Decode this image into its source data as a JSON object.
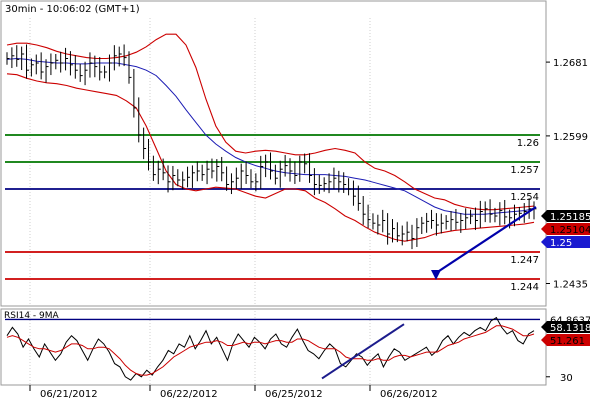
{
  "header": {
    "text": "30min - 10:06:02 (GMT+1)"
  },
  "colors": {
    "background": "#ffffff",
    "frame": "#9a9a9a",
    "grid": "#cfcfcf",
    "price": "#000000",
    "bollinger": "#cc0000",
    "moving_average": "#1c1cb4",
    "level_green": "#007700",
    "level_blue": "#000080",
    "level_red": "#cc0000",
    "trendline": "#1c1c8c",
    "forecast_arrow": "#0000aa",
    "tag_black": "#000000",
    "tag_red": "#cc0000",
    "tag_blue": "#1a1ad0"
  },
  "chart_data": [
    {
      "type": "line",
      "subtype": "ohlc-bars",
      "title": "",
      "x_ticks": [
        "06/21/2012",
        "06/22/2012",
        "06/25/2012",
        "06/26/2012"
      ],
      "y_ticks": [
        1.2681,
        1.2599,
        1.2435
      ],
      "ylim": [
        1.241,
        1.273
      ],
      "grid": true,
      "horizontal_levels": [
        {
          "value": 1.26,
          "label": "1.26",
          "color": "green"
        },
        {
          "value": 1.257,
          "label": "1.257",
          "color": "green"
        },
        {
          "value": 1.254,
          "label": "1.254",
          "color": "blue"
        },
        {
          "value": 1.247,
          "label": "1.247",
          "color": "red"
        },
        {
          "value": 1.244,
          "label": "1.244",
          "color": "red"
        }
      ],
      "value_tags": [
        {
          "value": 1.25185,
          "label": "1.25185",
          "style": "black"
        },
        {
          "value": 1.25104,
          "label": "1.25104",
          "style": "red"
        },
        {
          "value": 1.25,
          "label": "1.25",
          "style": "blue"
        }
      ],
      "series": [
        {
          "role": "price",
          "style": "ohlc",
          "values": [
            1.2685,
            1.2688,
            1.2684,
            1.269,
            1.2672,
            1.2678,
            1.268,
            1.267,
            1.2676,
            1.268,
            1.2683,
            1.268,
            1.2685,
            1.2678,
            1.2672,
            1.2666,
            1.2672,
            1.268,
            1.2676,
            1.267,
            1.267,
            1.268,
            1.2688,
            1.269,
            1.2686,
            1.2664,
            1.263,
            1.26,
            1.2585,
            1.257,
            1.2556,
            1.2562,
            1.2558,
            1.2548,
            1.2555,
            1.255,
            1.255,
            1.2553,
            1.2558,
            1.256,
            1.2556,
            1.2562,
            1.256,
            1.2565,
            1.2558,
            1.2545,
            1.2548,
            1.2552,
            1.256,
            1.2555,
            1.2548,
            1.2548,
            1.2565,
            1.257,
            1.256,
            1.2552,
            1.2562,
            1.2566,
            1.256,
            1.2555,
            1.257,
            1.2568,
            1.2555,
            1.2545,
            1.2544,
            1.2546,
            1.2548,
            1.2552,
            1.2548,
            1.2545,
            1.254,
            1.2532,
            1.2524,
            1.2512,
            1.2506,
            1.2502,
            1.25,
            1.2505,
            1.249,
            1.2496,
            1.2488,
            1.249,
            1.2492,
            1.2485,
            1.2497,
            1.2502,
            1.2504,
            1.2505,
            1.25,
            1.2502,
            1.2504,
            1.2506,
            1.2503,
            1.2505,
            1.2508,
            1.251,
            1.2505,
            1.2515,
            1.2518,
            1.2512,
            1.251,
            1.2516,
            1.2509,
            1.2508,
            1.2512,
            1.2513,
            1.2515,
            1.2518,
            1.2518
          ]
        },
        {
          "role": "bollinger_upper",
          "values": [
            1.27,
            1.2702,
            1.2702,
            1.27,
            1.2697,
            1.2693,
            1.269,
            1.2688,
            1.2686,
            1.2685,
            1.2685,
            1.2686,
            1.2688,
            1.2692,
            1.2698,
            1.2706,
            1.2712,
            1.2712,
            1.27,
            1.2675,
            1.264,
            1.261,
            1.2592,
            1.2582,
            1.258,
            1.2582,
            1.2583,
            1.2582,
            1.258,
            1.2578,
            1.2578,
            1.258,
            1.2583,
            1.2585,
            1.2583,
            1.258,
            1.257,
            1.2563,
            1.256,
            1.2555,
            1.2548,
            1.254,
            1.2535,
            1.253,
            1.2528,
            1.2523,
            1.252,
            1.2518,
            1.2517,
            1.2517,
            1.2518,
            1.2519,
            1.252,
            1.2521
          ]
        },
        {
          "role": "bollinger_lower",
          "values": [
            1.2668,
            1.2667,
            1.2663,
            1.266,
            1.2658,
            1.2657,
            1.2655,
            1.2652,
            1.265,
            1.2648,
            1.2646,
            1.2644,
            1.2638,
            1.263,
            1.261,
            1.2585,
            1.256,
            1.2545,
            1.254,
            1.2538,
            1.254,
            1.2542,
            1.2541,
            1.254,
            1.2536,
            1.2532,
            1.253,
            1.2535,
            1.254,
            1.254,
            1.2538,
            1.253,
            1.2525,
            1.2518,
            1.251,
            1.2505,
            1.2498,
            1.2492,
            1.2488,
            1.2484,
            1.2482,
            1.2484,
            1.2486,
            1.249,
            1.2492,
            1.2494,
            1.2495,
            1.2496,
            1.2497,
            1.2498,
            1.2499,
            1.25,
            1.2501,
            1.2503
          ]
        },
        {
          "role": "moving_average",
          "values": [
            1.2684,
            1.2685,
            1.2684,
            1.2682,
            1.2681,
            1.268,
            1.268,
            1.2679,
            1.2679,
            1.268,
            1.268,
            1.268,
            1.2678,
            1.2676,
            1.2672,
            1.2666,
            1.2655,
            1.2643,
            1.2628,
            1.2614,
            1.26,
            1.259,
            1.2582,
            1.2575,
            1.257,
            1.2566,
            1.2563,
            1.256,
            1.2558,
            1.2557,
            1.2556,
            1.2556,
            1.2556,
            1.2555,
            1.2554,
            1.2552,
            1.255,
            1.2547,
            1.2544,
            1.2541,
            1.2538,
            1.2532,
            1.2526,
            1.252,
            1.2516,
            1.2514,
            1.2512,
            1.2512,
            1.2512,
            1.2513,
            1.2514,
            1.2515,
            1.2516,
            1.2518
          ]
        }
      ],
      "annotations": [
        {
          "type": "forecast_arrow",
          "from": 1.252,
          "to": 1.244
        }
      ]
    },
    {
      "type": "line",
      "title": "RSI14 - 9MA",
      "y_ticks": [
        30.0
      ],
      "ylim": [
        25,
        70
      ],
      "horizontal_levels": [
        {
          "value": 64.8637,
          "label": "64.8637"
        }
      ],
      "value_tags": [
        {
          "value": 58.1318,
          "label": "58.1318",
          "style": "black"
        },
        {
          "value": 51.261,
          "label": "51.261",
          "style": "red"
        }
      ],
      "series": [
        {
          "role": "rsi",
          "color": "black",
          "values": [
            55,
            60,
            56,
            48,
            53,
            47,
            42,
            50,
            45,
            40,
            44,
            51,
            55,
            52,
            46,
            40,
            47,
            53,
            50,
            45,
            38,
            36,
            30,
            28,
            32,
            30,
            34,
            31,
            36,
            40,
            46,
            44,
            50,
            48,
            55,
            47,
            52,
            58,
            50,
            54,
            47,
            40,
            50,
            56,
            52,
            48,
            54,
            51,
            47,
            53,
            56,
            50,
            48,
            54,
            59,
            52,
            46,
            44,
            41,
            46,
            50,
            47,
            38,
            36,
            40,
            44,
            42,
            37,
            41,
            44,
            36,
            42,
            47,
            45,
            40,
            42,
            44,
            46,
            48,
            43,
            46,
            52,
            55,
            50,
            54,
            57,
            55,
            58,
            60,
            58,
            64,
            66,
            60,
            56,
            58,
            52,
            50,
            56,
            58
          ]
        },
        {
          "role": "rsi_ma",
          "color": "red",
          "values": [
            54,
            55,
            54,
            52,
            50,
            48,
            47,
            47,
            46,
            45,
            46,
            48,
            50,
            50,
            49,
            47,
            47,
            48,
            48,
            47,
            44,
            41,
            37,
            34,
            32,
            31,
            31,
            32,
            34,
            36,
            39,
            42,
            44,
            46,
            48,
            49,
            50,
            51,
            51,
            52,
            51,
            49,
            49,
            50,
            51,
            50,
            51,
            51,
            50,
            51,
            52,
            52,
            51,
            51,
            53,
            53,
            52,
            50,
            48,
            47,
            47,
            47,
            45,
            42,
            41,
            41,
            41,
            40,
            40,
            41,
            40,
            40,
            42,
            43,
            43,
            42,
            43,
            44,
            45,
            45,
            45,
            47,
            49,
            50,
            51,
            53,
            54,
            55,
            56,
            57,
            59,
            61,
            61,
            60,
            59,
            57,
            55,
            55,
            56
          ]
        }
      ],
      "annotations": [
        {
          "type": "trendline",
          "from": 29,
          "to": 62
        }
      ]
    }
  ]
}
